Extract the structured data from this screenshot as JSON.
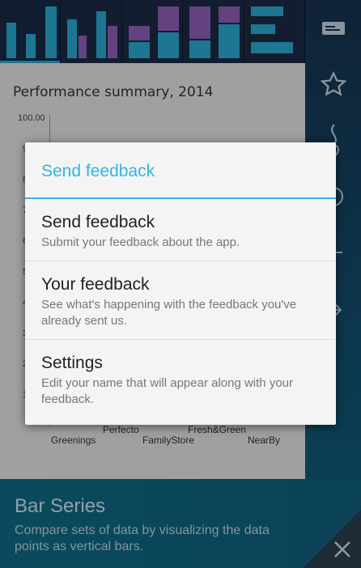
{
  "chart": {
    "title": "Performance summary, 2014",
    "yticks": [
      "100.00",
      "9",
      "8",
      "7",
      "6",
      "5",
      "4",
      "3",
      "2",
      "1"
    ],
    "categories_row1": [
      "Perfecto",
      "Fresh&Green"
    ],
    "categories_row2": [
      "Greenings",
      "FamilyStore",
      "NearBy"
    ]
  },
  "dialog": {
    "title": "Send feedback",
    "items": [
      {
        "title": "Send feedback",
        "subtitle": "Submit your feedback about the app."
      },
      {
        "title": "Your feedback",
        "subtitle": "See what's happening with the feedback you've already sent us."
      },
      {
        "title": "Settings",
        "subtitle": "Edit your name that will appear along with your feedback."
      }
    ]
  },
  "info": {
    "title": "Bar Series",
    "description": "Compare sets of data by visualizing the data points as vertical bars."
  },
  "icons": {
    "rail": [
      "card-icon",
      "star-icon",
      "flame-icon",
      "circle-icon",
      "minus-icon",
      "arrow-icon"
    ],
    "close": "close-icon"
  },
  "colors": {
    "accent": "#33b5e5",
    "bar_cyan": "#2aa9d2",
    "bar_purple": "#8f5fb6"
  }
}
